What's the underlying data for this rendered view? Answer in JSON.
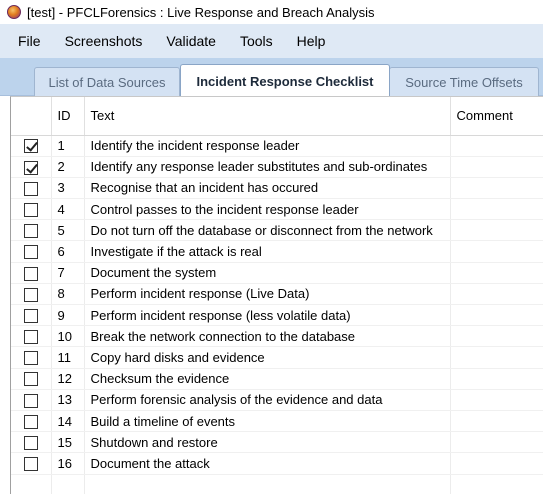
{
  "window": {
    "title": "[test] - PFCLForensics : Live Response and Breach Analysis"
  },
  "menu": [
    "File",
    "Screenshots",
    "Validate",
    "Tools",
    "Help"
  ],
  "tabs": [
    {
      "label": "List of Data Sources",
      "active": false
    },
    {
      "label": "Incident Response Checklist",
      "active": true
    },
    {
      "label": "Source Time Offsets",
      "active": false
    }
  ],
  "grid": {
    "columns": {
      "id": "ID",
      "text": "Text",
      "comment": "Comment"
    },
    "rows": [
      {
        "checked": true,
        "id": "1",
        "text": "Identify the incident response leader",
        "comment": ""
      },
      {
        "checked": true,
        "id": "2",
        "text": "Identify any response leader substitutes and sub-ordinates",
        "comment": ""
      },
      {
        "checked": false,
        "id": "3",
        "text": "Recognise that an incident has occured",
        "comment": ""
      },
      {
        "checked": false,
        "id": "4",
        "text": "Control passes to the incident response leader",
        "comment": ""
      },
      {
        "checked": false,
        "id": "5",
        "text": "Do not turn off the database or disconnect from the network",
        "comment": ""
      },
      {
        "checked": false,
        "id": "6",
        "text": "Investigate if the attack is real",
        "comment": ""
      },
      {
        "checked": false,
        "id": "7",
        "text": "Document the system",
        "comment": ""
      },
      {
        "checked": false,
        "id": "8",
        "text": "Perform incident response (Live Data)",
        "comment": ""
      },
      {
        "checked": false,
        "id": "9",
        "text": "Perform incident response (less volatile data)",
        "comment": ""
      },
      {
        "checked": false,
        "id": "10",
        "text": "Break the network connection to the database",
        "comment": ""
      },
      {
        "checked": false,
        "id": "11",
        "text": "Copy hard disks and evidence",
        "comment": ""
      },
      {
        "checked": false,
        "id": "12",
        "text": "Checksum the evidence",
        "comment": ""
      },
      {
        "checked": false,
        "id": "13",
        "text": "Perform forensic analysis of the evidence and data",
        "comment": ""
      },
      {
        "checked": false,
        "id": "14",
        "text": "Build a timeline of events",
        "comment": ""
      },
      {
        "checked": false,
        "id": "15",
        "text": "Shutdown and restore",
        "comment": ""
      },
      {
        "checked": false,
        "id": "16",
        "text": "Document the attack",
        "comment": ""
      }
    ]
  }
}
